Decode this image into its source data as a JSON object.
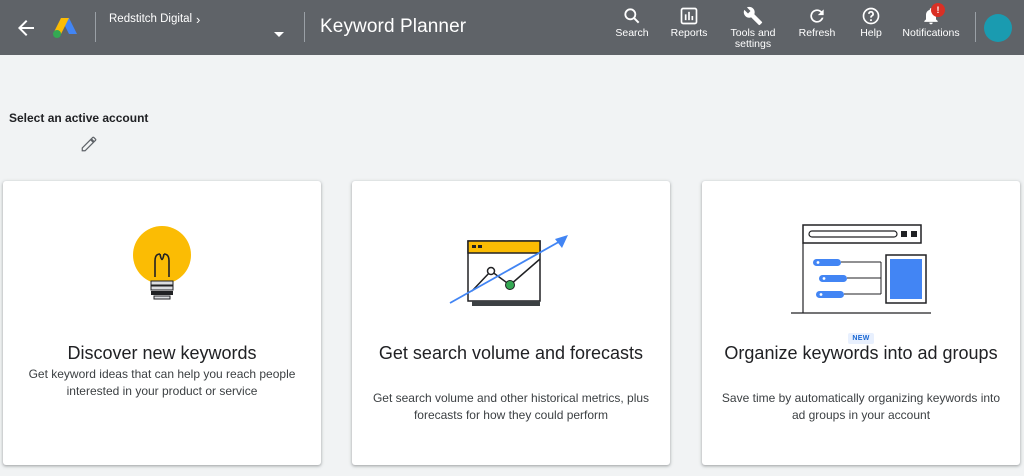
{
  "header": {
    "account_name": "Redstitch Digital",
    "account_chevron": "›",
    "title": "Keyword Planner",
    "tools": [
      {
        "label": "Search",
        "icon": "search-icon"
      },
      {
        "label": "Reports",
        "icon": "reports-icon"
      },
      {
        "label": "Tools and settings",
        "icon": "wrench-icon"
      },
      {
        "label": "Refresh",
        "icon": "refresh-icon"
      },
      {
        "label": "Help",
        "icon": "help-icon"
      },
      {
        "label": "Notifications",
        "icon": "bell-icon",
        "badge": "!"
      }
    ]
  },
  "main": {
    "select_account_label": "Select an active account"
  },
  "cards": [
    {
      "title": "Discover new keywords",
      "description": "Get keyword ideas that can help you reach people interested in your product or service"
    },
    {
      "title": "Get search volume and forecasts",
      "description": "Get search volume and other historical metrics, plus forecasts for how they could perform"
    },
    {
      "title": "Organize keywords into ad groups",
      "description": "Save time by automatically organizing keywords into ad groups in your account",
      "badge": "NEW"
    }
  ],
  "colors": {
    "topbar": "#5f6368",
    "background": "#f1f3f4",
    "accent_blue": "#4285f4",
    "accent_yellow": "#fbbc04",
    "accent_green": "#34a853",
    "badge_red": "#d93025",
    "avatar": "#1a9bb0"
  }
}
